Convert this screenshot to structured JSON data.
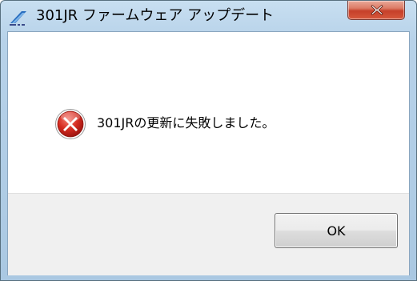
{
  "window": {
    "title": "301JR ファームウェア アップデート",
    "app_icon": "updater-app-icon",
    "close_icon": "close-x-icon"
  },
  "dialog": {
    "icon": "error-icon",
    "message": "301JRの更新に失敗しました。",
    "ok_label": "OK"
  },
  "colors": {
    "titlebar": "#b7d2e9",
    "close_button": "#c6402a",
    "error_red": "#c81e1e",
    "button_area": "#f0f0f0"
  }
}
